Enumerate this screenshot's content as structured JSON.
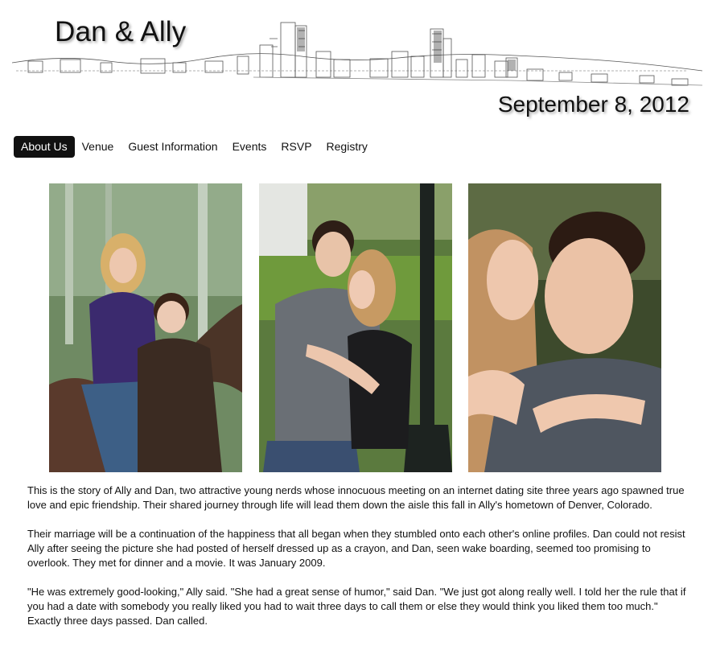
{
  "header": {
    "title": "Dan & Ally",
    "date": "September 8, 2012",
    "banner_icon": "city-skyline-sketch"
  },
  "nav": {
    "items": [
      {
        "label": "About Us",
        "active": true
      },
      {
        "label": "Venue",
        "active": false
      },
      {
        "label": "Guest Information",
        "active": false
      },
      {
        "label": "Events",
        "active": false
      },
      {
        "label": "RSVP",
        "active": false
      },
      {
        "label": "Registry",
        "active": false
      }
    ]
  },
  "photos": [
    {
      "name": "couple-tree-photo"
    },
    {
      "name": "couple-embrace-photo"
    },
    {
      "name": "couple-kiss-photo"
    }
  ],
  "story": {
    "paragraphs": [
      "This is the story of Ally and Dan, two attractive young nerds whose innocuous meeting on an internet dating site three years ago spawned true love and epic friendship. Their shared journey through life will lead them down the aisle this fall in Ally's hometown of Denver, Colorado.",
      "Their marriage will be a continuation of the happiness that all began when they stumbled onto each other's online profiles. Dan could not resist Ally after seeing the picture she had posted of herself dressed up as a crayon, and Dan, seen wake boarding, seemed too promising to overlook. They met for dinner and a movie. It was January 2009.",
      "\"He was extremely good-looking,\" Ally said. \"She had a great sense of humor,\" said Dan. \"We just got along really well. I told her the rule that if you had a date with somebody you really liked you had to wait three days to call them or else they would think you liked them too much.\" Exactly three days passed. Dan called."
    ]
  },
  "colors": {
    "nav_active_bg": "#111111",
    "nav_active_text": "#ffffff",
    "text": "#111111"
  }
}
